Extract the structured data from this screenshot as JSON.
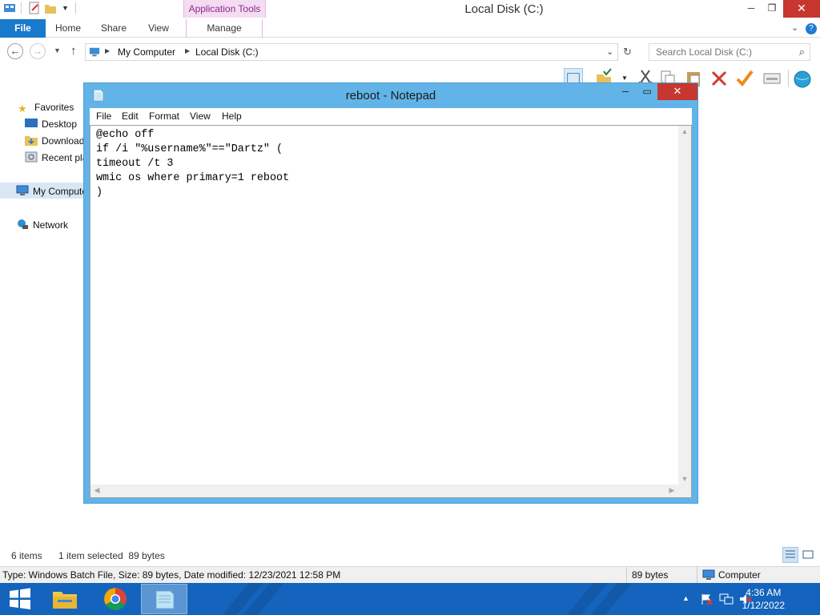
{
  "explorer": {
    "title": "Local Disk (C:)",
    "context_tab": "Application Tools",
    "tabs": [
      "File",
      "Home",
      "Share",
      "View",
      "Manage"
    ],
    "breadcrumb": [
      "My Computer",
      "Local Disk (C:)"
    ],
    "search_placeholder": "Search Local Disk (C:)",
    "nav": {
      "favorites": "Favorites",
      "desktop": "Desktop",
      "downloads": "Downloads",
      "recent": "Recent places",
      "computer": "My Computer",
      "network": "Network"
    },
    "status": {
      "items": "6 items",
      "selected": "1 item selected  89 bytes"
    },
    "info": {
      "details": "Type: Windows Batch File, Size: 89 bytes, Date modified: 12/23/2021 12:58 PM",
      "size": "89 bytes",
      "location": "Computer"
    }
  },
  "notepad": {
    "title": "reboot - Notepad",
    "menu": [
      "File",
      "Edit",
      "Format",
      "View",
      "Help"
    ],
    "content": "@echo off\nif /i \"%username%\"==\"Dartz\" (\ntimeout /t 3\nwmic os where primary=1 reboot\n)"
  },
  "taskbar": {
    "time": "4:36 AM",
    "date": "1/12/2022"
  },
  "colors": {
    "accent": "#1979ca",
    "notepad_frame": "#62b4e8",
    "close_red": "#c7372f",
    "taskbar": "#1464bd",
    "context_tab": "#f4dcf3"
  }
}
